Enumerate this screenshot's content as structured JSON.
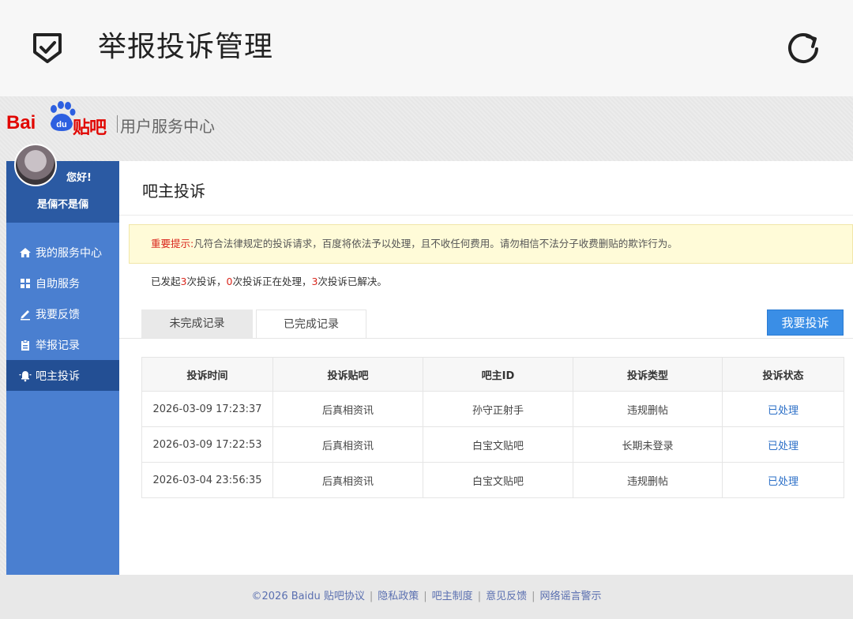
{
  "app": {
    "title": "举报投诉管理"
  },
  "brand": {
    "logo_bai": "Bai",
    "logo_du": "du",
    "logo_tieba": "贴吧",
    "service_center": "用户服务中心"
  },
  "user": {
    "greeting": "您好!",
    "name": "是倆不是倆"
  },
  "sidebar": {
    "items": [
      {
        "label": "我的服务中心",
        "icon": "home-icon"
      },
      {
        "label": "自助服务",
        "icon": "grid-icon"
      },
      {
        "label": "我要反馈",
        "icon": "pencil-icon"
      },
      {
        "label": "举报记录",
        "icon": "clipboard-icon"
      },
      {
        "label": "吧主投诉",
        "icon": "bell-icon",
        "active": true
      }
    ]
  },
  "main": {
    "heading": "吧主投诉",
    "notice_prefix": "重要提示:",
    "notice_text": "凡符合法律规定的投诉请求，百度将依法予以处理，且不收任何费用。请勿相信不法分子收费删贴的欺诈行为。",
    "stats": {
      "t1": "已发起",
      "n1": "3",
      "t2": "次投诉，",
      "n2": "0",
      "t3": "次投诉正在处理，",
      "n3": "3",
      "t4": "次投诉已解决。"
    },
    "tabs": [
      {
        "label": "未完成记录"
      },
      {
        "label": "已完成记录",
        "active": true
      }
    ],
    "complain_button": "我要投诉",
    "table": {
      "headers": [
        "投诉时间",
        "投诉贴吧",
        "吧主ID",
        "投诉类型",
        "投诉状态"
      ],
      "rows": [
        [
          "2026-03-09 17:23:37",
          "后真相资讯",
          "孙守正射手",
          "违规删帖",
          "已处理"
        ],
        [
          "2026-03-09 17:22:53",
          "后真相资讯",
          "白宝文贴吧",
          "长期未登录",
          "已处理"
        ],
        [
          "2026-03-04 23:56:35",
          "后真相资讯",
          "白宝文贴吧",
          "违规删帖",
          "已处理"
        ]
      ]
    }
  },
  "footer": {
    "copyright": "©2026 Baidu",
    "links": [
      "贴吧协议",
      "隐私政策",
      "吧主制度",
      "意见反馈",
      "网络谣言警示"
    ]
  },
  "colors": {
    "accent": "#3a8ee6",
    "sidebar": "#4a7fd0",
    "brand_red": "#e10601",
    "warn_red": "#d9261c"
  }
}
